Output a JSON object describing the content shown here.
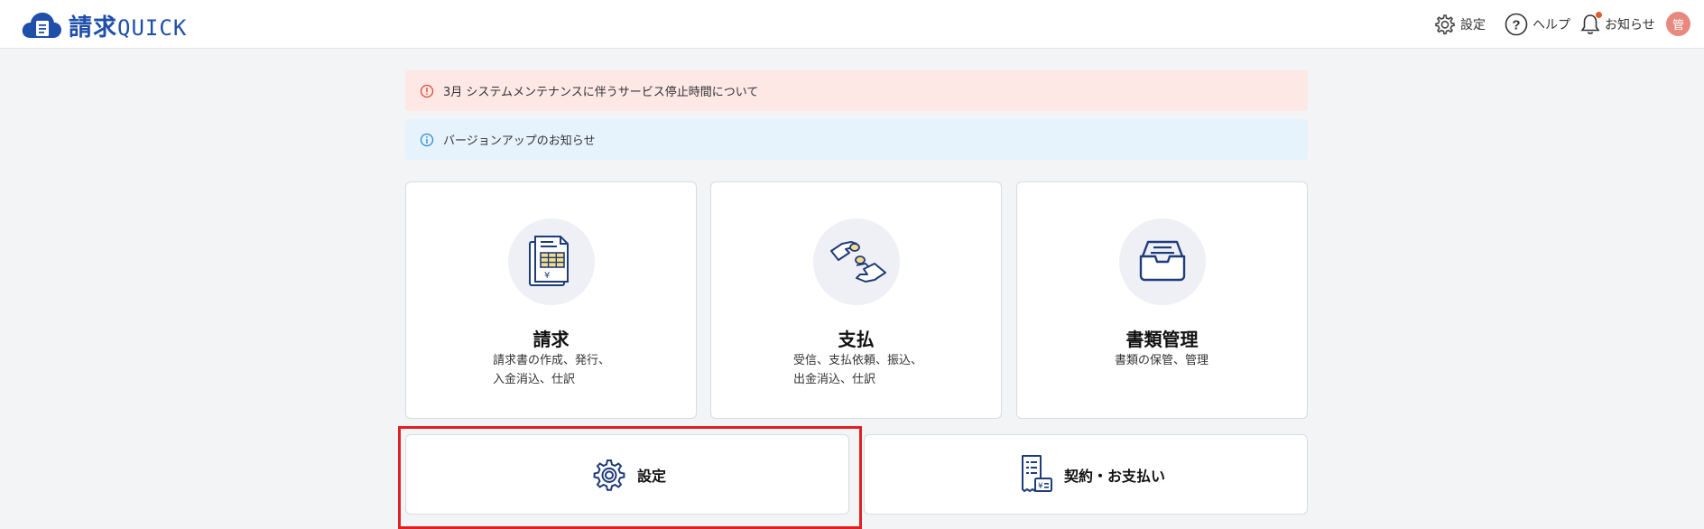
{
  "app": {
    "logo_main": "請求",
    "logo_sub": "QUICK"
  },
  "header": {
    "settings_label": "設定",
    "help_label": "ヘルプ",
    "notifications_label": "お知らせ",
    "avatar_initial": "管"
  },
  "alerts": [
    {
      "type": "error",
      "text": "3月 システムメンテナンスに伴うサービス停止時間について",
      "color": "#fde8e6"
    },
    {
      "type": "info",
      "text": "バージョンアップのお知らせ",
      "color": "#e6f3fc"
    }
  ],
  "cards": [
    {
      "title": "請求",
      "description": "請求書の作成、発行、\n入金消込、仕訳",
      "icon": "invoice-document-icon"
    },
    {
      "title": "支払",
      "description": "受信、支払依頼、振込、\n出金消込、仕訳",
      "icon": "hand-payment-icon"
    },
    {
      "title": "書類管理",
      "description": "書類の保管、管理",
      "icon": "document-tray-icon"
    }
  ],
  "bottom_buttons": [
    {
      "label": "設定",
      "icon": "gear-icon"
    },
    {
      "label": "契約・お支払い",
      "icon": "receipt-icon"
    }
  ],
  "colors": {
    "brand": "#1f4fa8",
    "highlight_border": "#e02020",
    "notification_dot": "#e15b2c"
  }
}
